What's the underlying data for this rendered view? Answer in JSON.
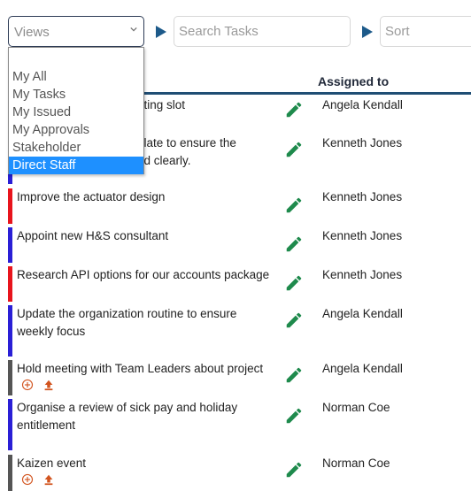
{
  "toolbar": {
    "views_placeholder": "Views",
    "search_placeholder": "Search Tasks",
    "sort_placeholder": "Sort"
  },
  "views_dropdown": {
    "options": [
      "My All",
      "My Tasks",
      "My Issued",
      "My Approvals",
      "Stakeholder",
      "Direct Staff"
    ],
    "highlighted": "Direct Staff"
  },
  "table": {
    "assigned_header": "Assigned to",
    "rows": [
      {
        "title": "Book the next meeting slot",
        "visible_title": "eting slot",
        "assignee": "Angela Kendall",
        "status_color": "#2a1fd6"
      },
      {
        "title": "Update the template to ensure the … is displayed clearly.",
        "visible_title_line1": "plate to ensure the",
        "visible_title_line2": "ed clearly.",
        "assignee": "Kenneth Jones",
        "status_color": "#2a1fd6"
      },
      {
        "title": "Improve the actuator design",
        "assignee": "Kenneth Jones",
        "status_color": "#e8141c"
      },
      {
        "title": "Appoint new H&S consultant",
        "assignee": "Kenneth Jones",
        "status_color": "#2a1fd6"
      },
      {
        "title": "Research API options for our accounts package",
        "assignee": "Kenneth Jones",
        "status_color": "#e8141c"
      },
      {
        "title": "Update the organization routine to ensure weekly focus",
        "assignee": "Angela Kendall",
        "status_color": "#2a1fd6"
      },
      {
        "title": "Hold meeting with Team Leaders about project",
        "assignee": "Angela Kendall",
        "status_color": "#555555",
        "has_actions": true
      },
      {
        "title": "Organise a review of sick pay and holiday entitlement",
        "assignee": "Norman Coe",
        "status_color": "#2a1fd6"
      },
      {
        "title": "Kaizen event",
        "assignee": "Norman Coe",
        "status_color": "#555555",
        "has_actions": true
      }
    ]
  },
  "icons": {
    "edit": "pencil-icon",
    "add": "circle-plus-icon",
    "escalate": "upload-arrow-icon"
  },
  "colors": {
    "accent": "#1f4e74",
    "edit_icon": "#1e8a4c",
    "action_icon": "#d2541f",
    "selection": "#1e90ff"
  }
}
